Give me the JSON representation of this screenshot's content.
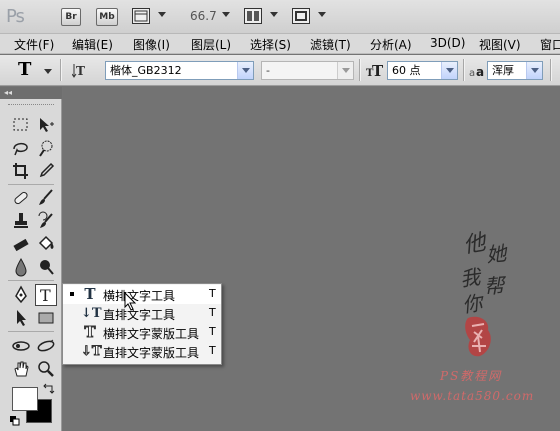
{
  "appbar": {
    "logo": "Ps",
    "bridge_label": "Br",
    "minibridge_label": "Mb",
    "zoom": "66.7"
  },
  "menu": [
    {
      "label": "文件(F)"
    },
    {
      "label": "编辑(E)"
    },
    {
      "label": "图像(I)"
    },
    {
      "label": "图层(L)"
    },
    {
      "label": "选择(S)"
    },
    {
      "label": "滤镜(T)"
    },
    {
      "label": "分析(A)"
    },
    {
      "label": "3D(D)"
    },
    {
      "label": "视图(V)"
    },
    {
      "label": "窗口"
    }
  ],
  "options": {
    "tool_glyph": "T",
    "font_family": "楷体_GB2312",
    "font_style": "-",
    "font_size": "60 点",
    "antialias": "浑厚",
    "size_icon_glyph": "T",
    "aa_glyph": "a"
  },
  "toolpanel": {
    "collapse": "◂◂"
  },
  "flyout": {
    "items": [
      {
        "icon": "T",
        "label": "横排文字工具",
        "key": "T"
      },
      {
        "icon": "↓T",
        "label": "直排文字工具",
        "key": "T"
      },
      {
        "icon": "T",
        "label": "横排文字蒙版工具",
        "key": "T"
      },
      {
        "icon": "↓T",
        "label": "直排文字蒙版工具",
        "key": "T"
      }
    ]
  },
  "watermark": {
    "chars": [
      "他",
      "她",
      "我",
      "帮",
      "你"
    ],
    "site_cn": "PS教程网",
    "site_url": "www.tata580.com"
  },
  "colors": {
    "canvas": "#737373",
    "panel": "#d9d9d9",
    "accent": "#d06a6a"
  }
}
